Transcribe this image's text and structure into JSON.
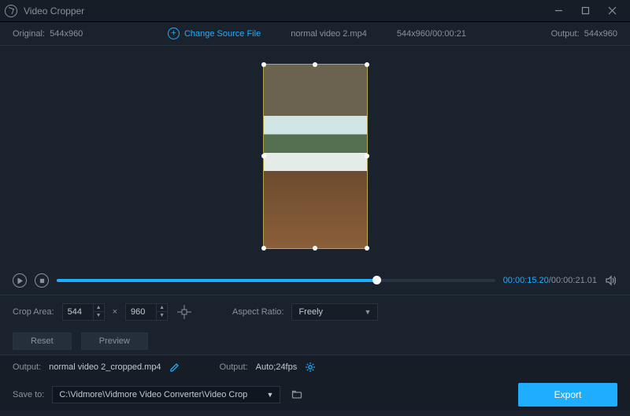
{
  "window": {
    "title": "Video Cropper"
  },
  "info": {
    "original_label": "Original:",
    "original_dims": "544x960",
    "change_source": "Change Source File",
    "filename": "normal video 2.mp4",
    "source_meta": "544x960/00:00:21",
    "output_label": "Output:",
    "output_dims": "544x960"
  },
  "player": {
    "current_time": "00:00:15.20",
    "total_time": "00:00:21.01"
  },
  "options": {
    "crop_area_label": "Crop Area:",
    "width": "544",
    "height": "960",
    "times": "×",
    "aspect_label": "Aspect Ratio:",
    "aspect_value": "Freely"
  },
  "buttons": {
    "reset": "Reset",
    "preview": "Preview",
    "export": "Export"
  },
  "output": {
    "output_label": "Output:",
    "filename": "normal video 2_cropped.mp4",
    "format_label": "Output:",
    "format_value": "Auto;24fps",
    "save_label": "Save to:",
    "save_path": "C:\\Vidmore\\Vidmore Video Converter\\Video Crop"
  }
}
